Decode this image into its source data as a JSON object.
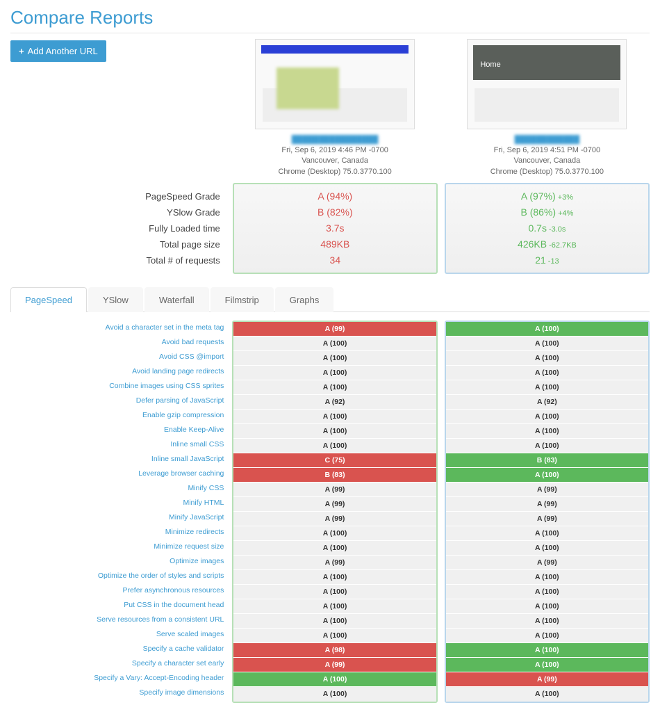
{
  "page_title": "Compare Reports",
  "add_button": "Add Another URL",
  "reports": [
    {
      "timestamp": "Fri, Sep 6, 2019 4:46 PM -0700",
      "location": "Vancouver, Canada",
      "browser": "Chrome (Desktop) 75.0.3770.100"
    },
    {
      "timestamp": "Fri, Sep 6, 2019 4:51 PM -0700",
      "location": "Vancouver, Canada",
      "browser": "Chrome (Desktop) 75.0.3770.100"
    }
  ],
  "summary_labels": {
    "pagespeed": "PageSpeed Grade",
    "yslow": "YSlow Grade",
    "load": "Fully Loaded time",
    "size": "Total page size",
    "requests": "Total # of requests"
  },
  "summary": {
    "left": {
      "pagespeed": "A (94%)",
      "yslow": "B (82%)",
      "load": "3.7s",
      "size": "489KB",
      "requests": "34"
    },
    "right": {
      "pagespeed": "A (97%)",
      "pagespeed_delta": "+3%",
      "yslow": "B (86%)",
      "yslow_delta": "+4%",
      "load": "0.7s",
      "load_delta": "-3.0s",
      "size": "426KB",
      "size_delta": "-62.7KB",
      "requests": "21",
      "requests_delta": "-13"
    }
  },
  "tabs": [
    "PageSpeed",
    "YSlow",
    "Waterfall",
    "Filmstrip",
    "Graphs"
  ],
  "rules": [
    {
      "label": "Avoid a character set in the meta tag",
      "l": {
        "t": "A (99)",
        "c": "red"
      },
      "r": {
        "t": "A (100)",
        "c": "green"
      }
    },
    {
      "label": "Avoid bad requests",
      "l": {
        "t": "A (100)",
        "c": ""
      },
      "r": {
        "t": "A (100)",
        "c": ""
      }
    },
    {
      "label": "Avoid CSS @import",
      "l": {
        "t": "A (100)",
        "c": ""
      },
      "r": {
        "t": "A (100)",
        "c": ""
      }
    },
    {
      "label": "Avoid landing page redirects",
      "l": {
        "t": "A (100)",
        "c": ""
      },
      "r": {
        "t": "A (100)",
        "c": ""
      }
    },
    {
      "label": "Combine images using CSS sprites",
      "l": {
        "t": "A (100)",
        "c": ""
      },
      "r": {
        "t": "A (100)",
        "c": ""
      }
    },
    {
      "label": "Defer parsing of JavaScript",
      "l": {
        "t": "A (92)",
        "c": ""
      },
      "r": {
        "t": "A (92)",
        "c": ""
      }
    },
    {
      "label": "Enable gzip compression",
      "l": {
        "t": "A (100)",
        "c": ""
      },
      "r": {
        "t": "A (100)",
        "c": ""
      }
    },
    {
      "label": "Enable Keep-Alive",
      "l": {
        "t": "A (100)",
        "c": ""
      },
      "r": {
        "t": "A (100)",
        "c": ""
      }
    },
    {
      "label": "Inline small CSS",
      "l": {
        "t": "A (100)",
        "c": ""
      },
      "r": {
        "t": "A (100)",
        "c": ""
      }
    },
    {
      "label": "Inline small JavaScript",
      "l": {
        "t": "C (75)",
        "c": "red"
      },
      "r": {
        "t": "B (83)",
        "c": "green"
      }
    },
    {
      "label": "Leverage browser caching",
      "l": {
        "t": "B (83)",
        "c": "red"
      },
      "r": {
        "t": "A (100)",
        "c": "green"
      }
    },
    {
      "label": "Minify CSS",
      "l": {
        "t": "A (99)",
        "c": ""
      },
      "r": {
        "t": "A (99)",
        "c": ""
      }
    },
    {
      "label": "Minify HTML",
      "l": {
        "t": "A (99)",
        "c": ""
      },
      "r": {
        "t": "A (99)",
        "c": ""
      }
    },
    {
      "label": "Minify JavaScript",
      "l": {
        "t": "A (99)",
        "c": ""
      },
      "r": {
        "t": "A (99)",
        "c": ""
      }
    },
    {
      "label": "Minimize redirects",
      "l": {
        "t": "A (100)",
        "c": ""
      },
      "r": {
        "t": "A (100)",
        "c": ""
      }
    },
    {
      "label": "Minimize request size",
      "l": {
        "t": "A (100)",
        "c": ""
      },
      "r": {
        "t": "A (100)",
        "c": ""
      }
    },
    {
      "label": "Optimize images",
      "l": {
        "t": "A (99)",
        "c": ""
      },
      "r": {
        "t": "A (99)",
        "c": ""
      }
    },
    {
      "label": "Optimize the order of styles and scripts",
      "l": {
        "t": "A (100)",
        "c": ""
      },
      "r": {
        "t": "A (100)",
        "c": ""
      }
    },
    {
      "label": "Prefer asynchronous resources",
      "l": {
        "t": "A (100)",
        "c": ""
      },
      "r": {
        "t": "A (100)",
        "c": ""
      }
    },
    {
      "label": "Put CSS in the document head",
      "l": {
        "t": "A (100)",
        "c": ""
      },
      "r": {
        "t": "A (100)",
        "c": ""
      }
    },
    {
      "label": "Serve resources from a consistent URL",
      "l": {
        "t": "A (100)",
        "c": ""
      },
      "r": {
        "t": "A (100)",
        "c": ""
      }
    },
    {
      "label": "Serve scaled images",
      "l": {
        "t": "A (100)",
        "c": ""
      },
      "r": {
        "t": "A (100)",
        "c": ""
      }
    },
    {
      "label": "Specify a cache validator",
      "l": {
        "t": "A (98)",
        "c": "red"
      },
      "r": {
        "t": "A (100)",
        "c": "green"
      }
    },
    {
      "label": "Specify a character set early",
      "l": {
        "t": "A (99)",
        "c": "red"
      },
      "r": {
        "t": "A (100)",
        "c": "green"
      }
    },
    {
      "label": "Specify a Vary: Accept-Encoding header",
      "l": {
        "t": "A (100)",
        "c": "green"
      },
      "r": {
        "t": "A (99)",
        "c": "red"
      }
    },
    {
      "label": "Specify image dimensions",
      "l": {
        "t": "A (100)",
        "c": ""
      },
      "r": {
        "t": "A (100)",
        "c": ""
      }
    }
  ]
}
